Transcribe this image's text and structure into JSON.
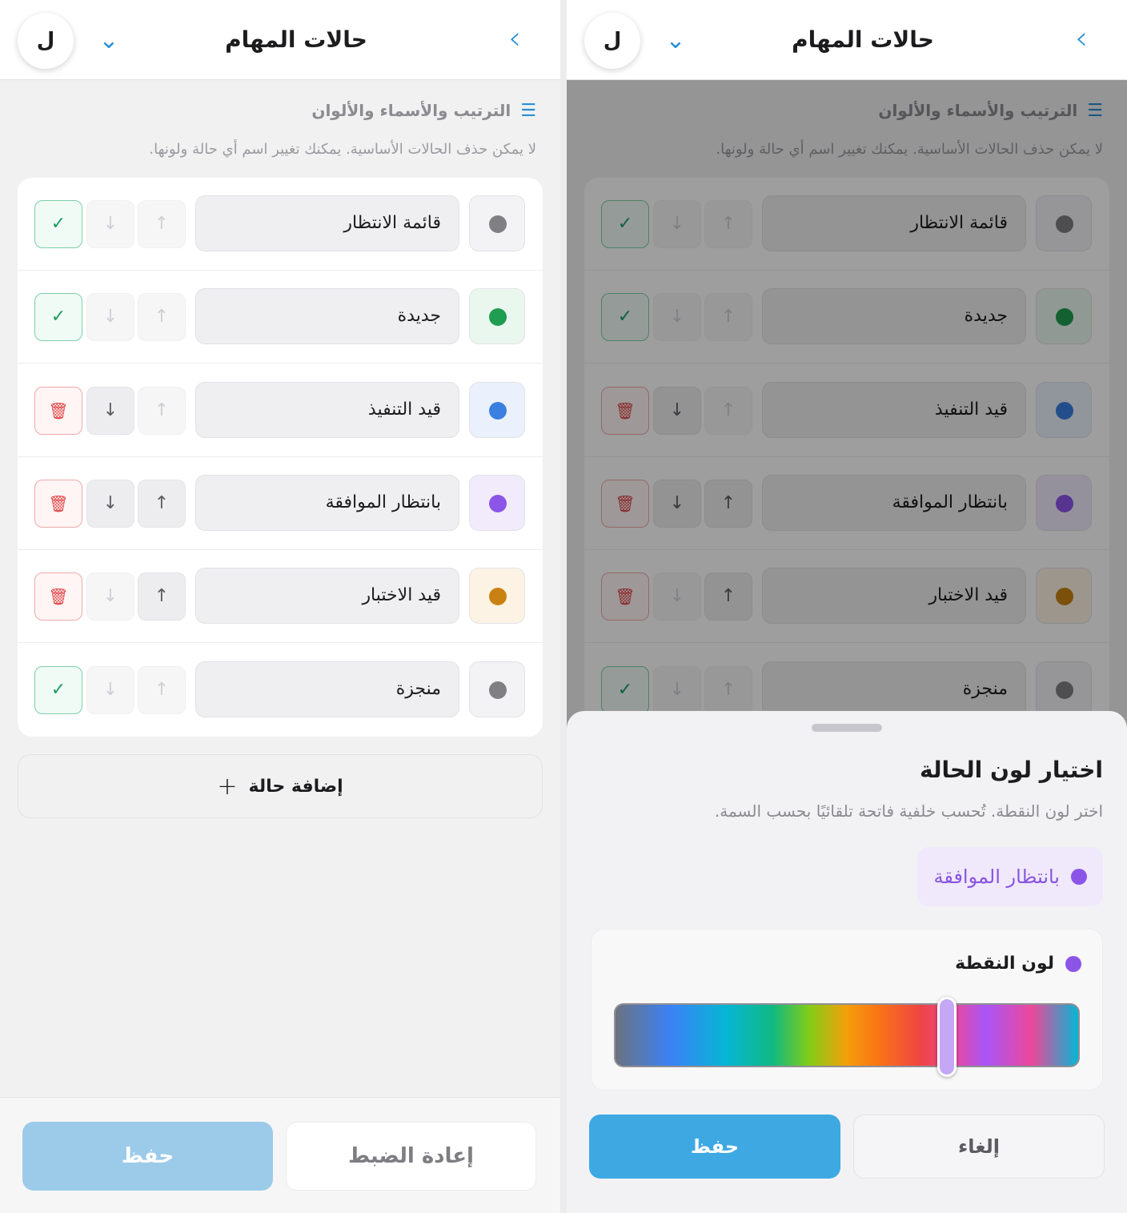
{
  "header": {
    "title": "حالات المهام",
    "avatar_letter": "ل",
    "back_icon": "chevron-right-icon",
    "menu_icon": "chevron-down-icon"
  },
  "section": {
    "title": "الترتيب والأسماء والألوان",
    "icon": "checklist-icon",
    "hint": "لا يمكن حذف الحالات الأساسية. يمكنك تغيير اسم أي حالة ولونها."
  },
  "statuses": [
    {
      "name": "قائمة الانتظار",
      "dot_color": "#7f7f84",
      "dot_bg": "#f3f3f5",
      "up_enabled": false,
      "down_enabled": false,
      "action": "check"
    },
    {
      "name": "جديدة",
      "dot_color": "#1f9d50",
      "dot_bg": "#eaf7ef",
      "up_enabled": false,
      "down_enabled": false,
      "action": "check"
    },
    {
      "name": "قيد التنفيذ",
      "dot_color": "#3b7fe0",
      "dot_bg": "#eaf1fc",
      "up_enabled": false,
      "down_enabled": true,
      "action": "delete"
    },
    {
      "name": "بانتظار الموافقة",
      "dot_color": "#8b55e8",
      "dot_bg": "#f1ebfc",
      "up_enabled": true,
      "down_enabled": true,
      "action": "delete"
    },
    {
      "name": "قيد الاختبار",
      "dot_color": "#c98212",
      "dot_bg": "#fdf3e4",
      "up_enabled": true,
      "down_enabled": false,
      "action": "delete"
    },
    {
      "name": "منجزة",
      "dot_color": "#7f7f84",
      "dot_bg": "#f3f3f5",
      "up_enabled": false,
      "down_enabled": false,
      "action": "check"
    }
  ],
  "add_status": {
    "label": "إضافة حالة",
    "icon": "+"
  },
  "footer": {
    "save_label": "حفظ",
    "reset_label": "إعادة الضبط"
  },
  "color_sheet": {
    "title": "اختيار لون الحالة",
    "subtitle": "اختر لون النقطة. تُحسب خلفية فاتحة تلقائيًا بحسب السمة.",
    "preview_label": "بانتظار الموافقة",
    "preview_color": "#8b55e8",
    "dot_color_label": "لون النقطة",
    "hue_value": 0.715,
    "save_label": "حفظ",
    "cancel_label": "إلغاء"
  }
}
